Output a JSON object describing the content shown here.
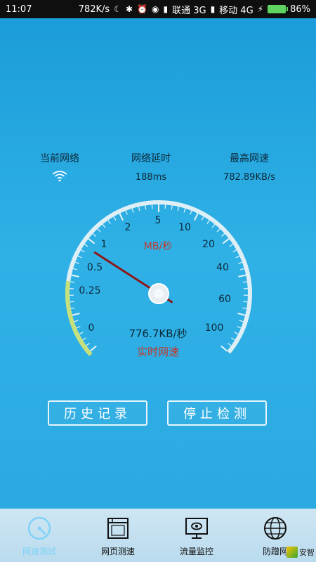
{
  "status_bar": {
    "time": "11:07",
    "net_speed": "782K/s",
    "carrier1": "联通 3G",
    "carrier2": "移动 4G",
    "battery": "86%"
  },
  "info": {
    "network_label": "当前网络",
    "latency_label": "网络延时",
    "latency_value": "188ms",
    "max_speed_label": "最高网速",
    "max_speed_value": "782.89KB/s"
  },
  "gauge": {
    "unit": "MB/秒",
    "ticks": [
      "0",
      "0.25",
      "0.5",
      "1",
      "2",
      "5",
      "10",
      "20",
      "40",
      "60",
      "100"
    ],
    "current_speed": "776.7KB/秒",
    "current_label": "实时网速",
    "needle_tick_fraction": 0.28
  },
  "buttons": {
    "history": "历史记录",
    "stop": "停止检测"
  },
  "nav": {
    "items": [
      {
        "label": "网速测试"
      },
      {
        "label": "网页测速"
      },
      {
        "label": "流量监控"
      },
      {
        "label": "防蹭网"
      }
    ]
  },
  "watermark": "安智",
  "colors": {
    "background": "#2aa8e0",
    "needle": "#8b1a1a",
    "unit_text": "#c0392b",
    "active_nav": "#7fd2f7"
  }
}
